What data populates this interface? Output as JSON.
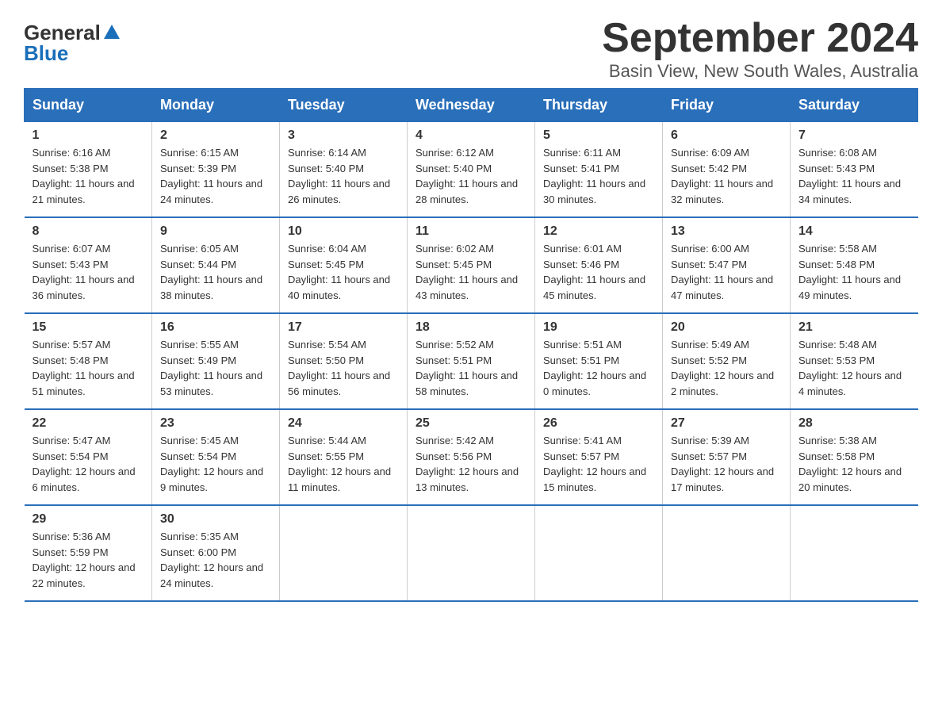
{
  "header": {
    "logo_general": "General",
    "logo_blue": "Blue",
    "title": "September 2024",
    "subtitle": "Basin View, New South Wales, Australia"
  },
  "days_of_week": [
    "Sunday",
    "Monday",
    "Tuesday",
    "Wednesday",
    "Thursday",
    "Friday",
    "Saturday"
  ],
  "weeks": [
    [
      {
        "date": "1",
        "sunrise": "Sunrise: 6:16 AM",
        "sunset": "Sunset: 5:38 PM",
        "daylight": "Daylight: 11 hours and 21 minutes."
      },
      {
        "date": "2",
        "sunrise": "Sunrise: 6:15 AM",
        "sunset": "Sunset: 5:39 PM",
        "daylight": "Daylight: 11 hours and 24 minutes."
      },
      {
        "date": "3",
        "sunrise": "Sunrise: 6:14 AM",
        "sunset": "Sunset: 5:40 PM",
        "daylight": "Daylight: 11 hours and 26 minutes."
      },
      {
        "date": "4",
        "sunrise": "Sunrise: 6:12 AM",
        "sunset": "Sunset: 5:40 PM",
        "daylight": "Daylight: 11 hours and 28 minutes."
      },
      {
        "date": "5",
        "sunrise": "Sunrise: 6:11 AM",
        "sunset": "Sunset: 5:41 PM",
        "daylight": "Daylight: 11 hours and 30 minutes."
      },
      {
        "date": "6",
        "sunrise": "Sunrise: 6:09 AM",
        "sunset": "Sunset: 5:42 PM",
        "daylight": "Daylight: 11 hours and 32 minutes."
      },
      {
        "date": "7",
        "sunrise": "Sunrise: 6:08 AM",
        "sunset": "Sunset: 5:43 PM",
        "daylight": "Daylight: 11 hours and 34 minutes."
      }
    ],
    [
      {
        "date": "8",
        "sunrise": "Sunrise: 6:07 AM",
        "sunset": "Sunset: 5:43 PM",
        "daylight": "Daylight: 11 hours and 36 minutes."
      },
      {
        "date": "9",
        "sunrise": "Sunrise: 6:05 AM",
        "sunset": "Sunset: 5:44 PM",
        "daylight": "Daylight: 11 hours and 38 minutes."
      },
      {
        "date": "10",
        "sunrise": "Sunrise: 6:04 AM",
        "sunset": "Sunset: 5:45 PM",
        "daylight": "Daylight: 11 hours and 40 minutes."
      },
      {
        "date": "11",
        "sunrise": "Sunrise: 6:02 AM",
        "sunset": "Sunset: 5:45 PM",
        "daylight": "Daylight: 11 hours and 43 minutes."
      },
      {
        "date": "12",
        "sunrise": "Sunrise: 6:01 AM",
        "sunset": "Sunset: 5:46 PM",
        "daylight": "Daylight: 11 hours and 45 minutes."
      },
      {
        "date": "13",
        "sunrise": "Sunrise: 6:00 AM",
        "sunset": "Sunset: 5:47 PM",
        "daylight": "Daylight: 11 hours and 47 minutes."
      },
      {
        "date": "14",
        "sunrise": "Sunrise: 5:58 AM",
        "sunset": "Sunset: 5:48 PM",
        "daylight": "Daylight: 11 hours and 49 minutes."
      }
    ],
    [
      {
        "date": "15",
        "sunrise": "Sunrise: 5:57 AM",
        "sunset": "Sunset: 5:48 PM",
        "daylight": "Daylight: 11 hours and 51 minutes."
      },
      {
        "date": "16",
        "sunrise": "Sunrise: 5:55 AM",
        "sunset": "Sunset: 5:49 PM",
        "daylight": "Daylight: 11 hours and 53 minutes."
      },
      {
        "date": "17",
        "sunrise": "Sunrise: 5:54 AM",
        "sunset": "Sunset: 5:50 PM",
        "daylight": "Daylight: 11 hours and 56 minutes."
      },
      {
        "date": "18",
        "sunrise": "Sunrise: 5:52 AM",
        "sunset": "Sunset: 5:51 PM",
        "daylight": "Daylight: 11 hours and 58 minutes."
      },
      {
        "date": "19",
        "sunrise": "Sunrise: 5:51 AM",
        "sunset": "Sunset: 5:51 PM",
        "daylight": "Daylight: 12 hours and 0 minutes."
      },
      {
        "date": "20",
        "sunrise": "Sunrise: 5:49 AM",
        "sunset": "Sunset: 5:52 PM",
        "daylight": "Daylight: 12 hours and 2 minutes."
      },
      {
        "date": "21",
        "sunrise": "Sunrise: 5:48 AM",
        "sunset": "Sunset: 5:53 PM",
        "daylight": "Daylight: 12 hours and 4 minutes."
      }
    ],
    [
      {
        "date": "22",
        "sunrise": "Sunrise: 5:47 AM",
        "sunset": "Sunset: 5:54 PM",
        "daylight": "Daylight: 12 hours and 6 minutes."
      },
      {
        "date": "23",
        "sunrise": "Sunrise: 5:45 AM",
        "sunset": "Sunset: 5:54 PM",
        "daylight": "Daylight: 12 hours and 9 minutes."
      },
      {
        "date": "24",
        "sunrise": "Sunrise: 5:44 AM",
        "sunset": "Sunset: 5:55 PM",
        "daylight": "Daylight: 12 hours and 11 minutes."
      },
      {
        "date": "25",
        "sunrise": "Sunrise: 5:42 AM",
        "sunset": "Sunset: 5:56 PM",
        "daylight": "Daylight: 12 hours and 13 minutes."
      },
      {
        "date": "26",
        "sunrise": "Sunrise: 5:41 AM",
        "sunset": "Sunset: 5:57 PM",
        "daylight": "Daylight: 12 hours and 15 minutes."
      },
      {
        "date": "27",
        "sunrise": "Sunrise: 5:39 AM",
        "sunset": "Sunset: 5:57 PM",
        "daylight": "Daylight: 12 hours and 17 minutes."
      },
      {
        "date": "28",
        "sunrise": "Sunrise: 5:38 AM",
        "sunset": "Sunset: 5:58 PM",
        "daylight": "Daylight: 12 hours and 20 minutes."
      }
    ],
    [
      {
        "date": "29",
        "sunrise": "Sunrise: 5:36 AM",
        "sunset": "Sunset: 5:59 PM",
        "daylight": "Daylight: 12 hours and 22 minutes."
      },
      {
        "date": "30",
        "sunrise": "Sunrise: 5:35 AM",
        "sunset": "Sunset: 6:00 PM",
        "daylight": "Daylight: 12 hours and 24 minutes."
      },
      null,
      null,
      null,
      null,
      null
    ]
  ]
}
